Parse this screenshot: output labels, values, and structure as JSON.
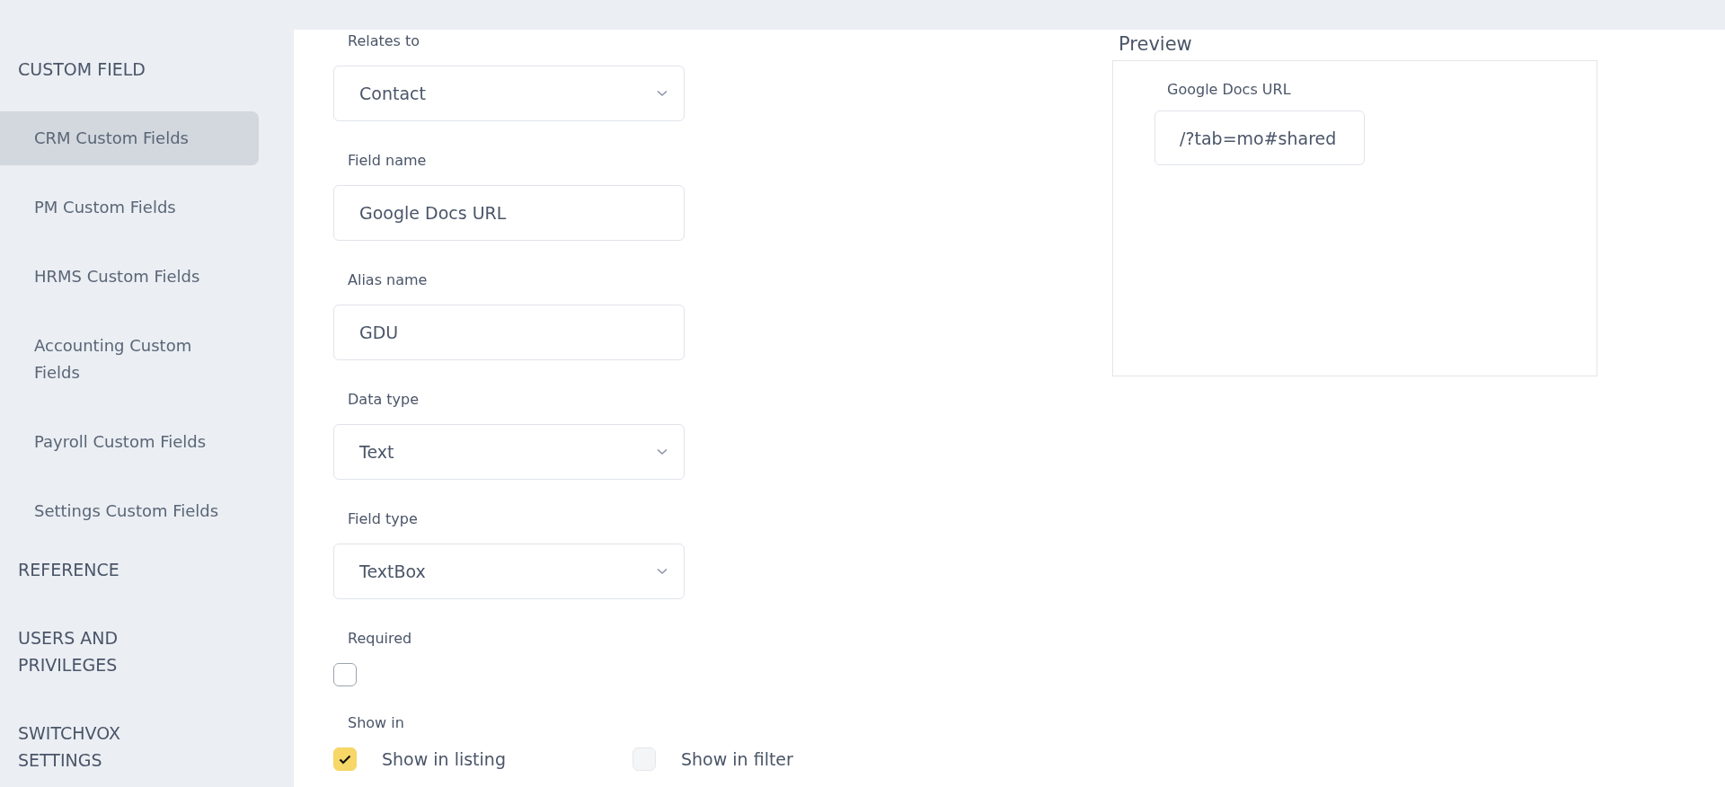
{
  "sidebar": {
    "sections": [
      {
        "title": "CUSTOM FIELD",
        "items": [
          {
            "label": "CRM Custom Fields",
            "selected": true
          },
          {
            "label": "PM Custom Fields",
            "selected": false
          },
          {
            "label": "HRMS Custom Fields",
            "selected": false
          },
          {
            "label": "Accounting Custom Fields",
            "selected": false
          },
          {
            "label": "Payroll Custom Fields",
            "selected": false
          },
          {
            "label": "Settings Custom Fields",
            "selected": false
          }
        ]
      },
      {
        "title": "REFERENCE"
      },
      {
        "title": "USERS AND PRIVILEGES"
      },
      {
        "title": "SWITCHVOX SETTINGS"
      }
    ]
  },
  "form": {
    "fields": [
      {
        "label": "Relates to",
        "kind": "select",
        "value": "Contact"
      },
      {
        "label": "Field name",
        "kind": "text",
        "value": "Google Docs URL"
      },
      {
        "label": "Alias name",
        "kind": "text",
        "value": "GDU"
      },
      {
        "label": "Data type",
        "kind": "select",
        "value": "Text"
      },
      {
        "label": "Field type",
        "kind": "select",
        "value": "TextBox"
      }
    ],
    "required": {
      "label": "Required",
      "checked": false
    },
    "show_in": {
      "label": "Show in",
      "options": [
        {
          "label": "Show in listing",
          "checked": true,
          "disabled": false
        },
        {
          "label": "Show in filter",
          "checked": false,
          "disabled": true
        }
      ]
    }
  },
  "preview": {
    "title": "Preview",
    "field_label": "Google Docs URL",
    "field_value": "/?tab=mo#shared"
  }
}
